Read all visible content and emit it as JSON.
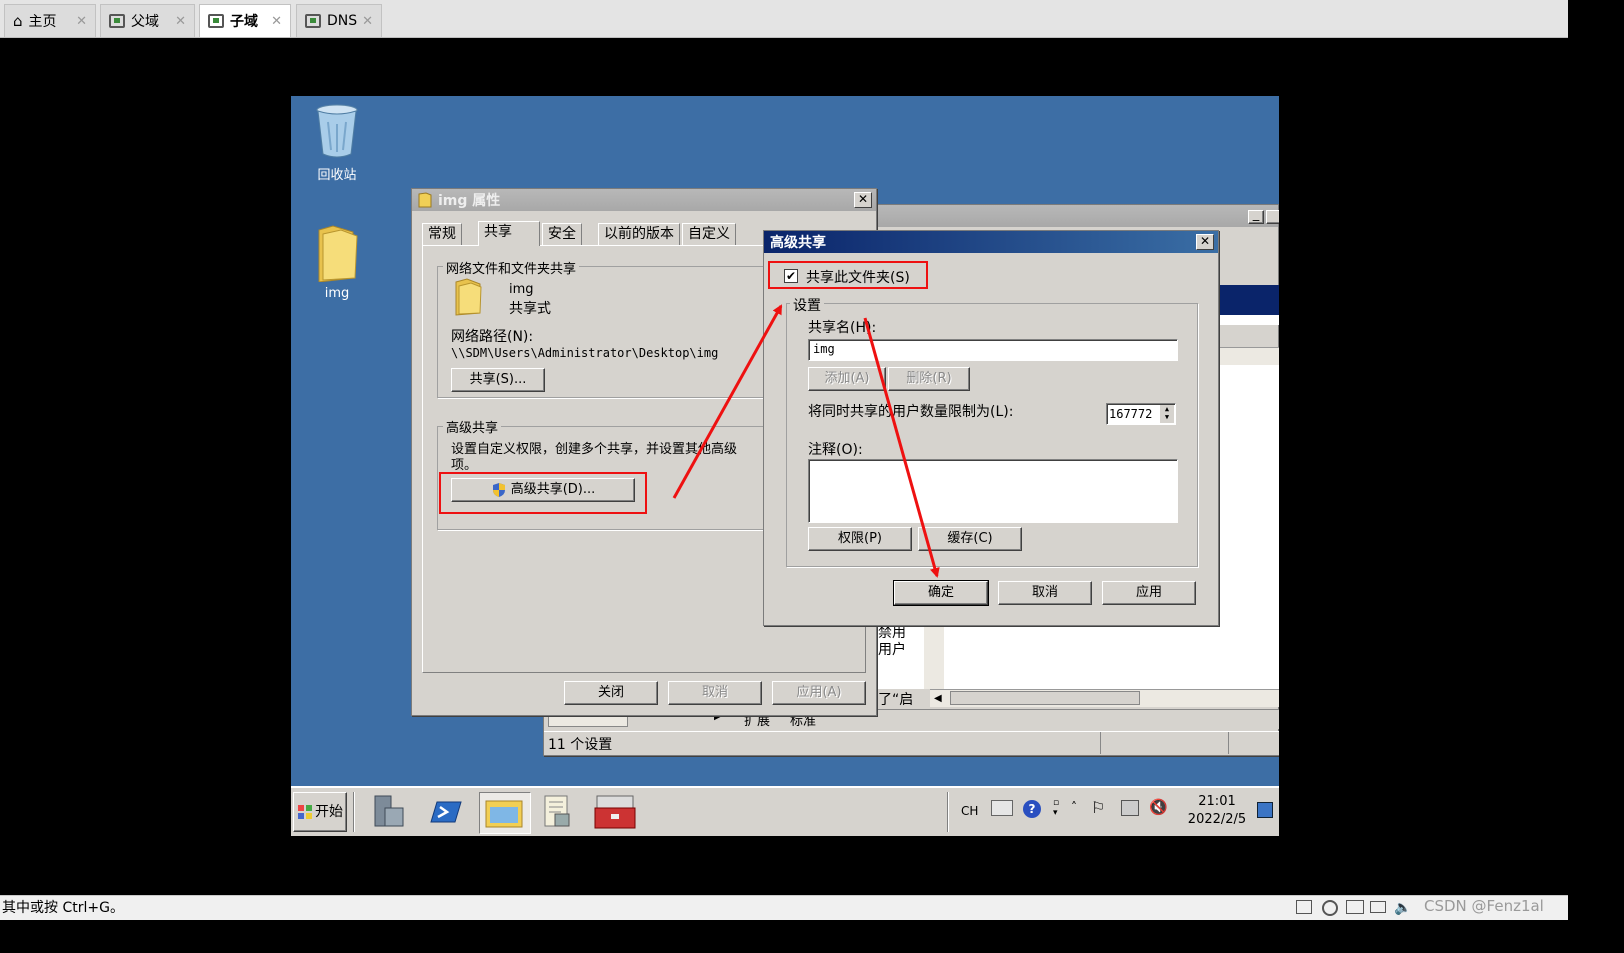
{
  "vm_tabs": [
    {
      "label": "主页",
      "icon": "home-icon"
    },
    {
      "label": "父域",
      "icon": "vm-icon"
    },
    {
      "label": "子域",
      "icon": "vm-icon"
    },
    {
      "label": "DNS",
      "icon": "vm-icon"
    }
  ],
  "desktop": {
    "recycle_bin": "回收站",
    "img_folder": "img"
  },
  "properties": {
    "title": "img 属性",
    "tabs": [
      "常规",
      "共享",
      "安全",
      "以前的版本",
      "自定义"
    ],
    "network_group": "网络文件和文件夹共享",
    "folder_name": "img",
    "folder_status": "共享式",
    "network_path_label": "网络路径(N):",
    "network_path": "\\\\SDM\\Users\\Administrator\\Desktop\\img",
    "share_button": "共享(S)...",
    "advanced_group": "高级共享",
    "advanced_desc": "设置自定义权限，创建多个共享，并设置其他高级",
    "advanced_desc2": "项。",
    "advanced_button": "高级共享(D)...",
    "close_button": "关闭",
    "cancel_button": "取消",
    "apply_button": "应用(A)"
  },
  "advanced": {
    "title": "高级共享",
    "share_checkbox": "共享此文件夹(S)",
    "share_checked": true,
    "settings_group": "设置",
    "share_name_label": "共享名(H):",
    "share_name_value": "img",
    "add_button": "添加(A)",
    "remove_button": "删除(R)",
    "limit_label": "将同时共享的用户数量限制为(L):",
    "limit_value": "167772",
    "comment_label": "注释(O):",
    "permissions_button": "权限(P)",
    "cache_button": "缓存(C)",
    "ok_button": "确定",
    "cancel_button": "取消",
    "apply_button": "应用"
  },
  "background_window": {
    "text1": "禁用",
    "text2": "用户",
    "text3": "了“启",
    "tab_ext": "扩展",
    "tab_std": "标准",
    "status": "11 个设置"
  },
  "taskbar": {
    "start": "开始",
    "lang": "CH",
    "time": "21:01",
    "date": "2022/2/5"
  },
  "statusbar": {
    "hint": "其中或按 Ctrl+G。",
    "watermark": "CSDN @Fenz1al"
  },
  "colors": {
    "desktop": "#3d6ea5",
    "title_active": "#0a246a",
    "annotation": "#e11111"
  }
}
